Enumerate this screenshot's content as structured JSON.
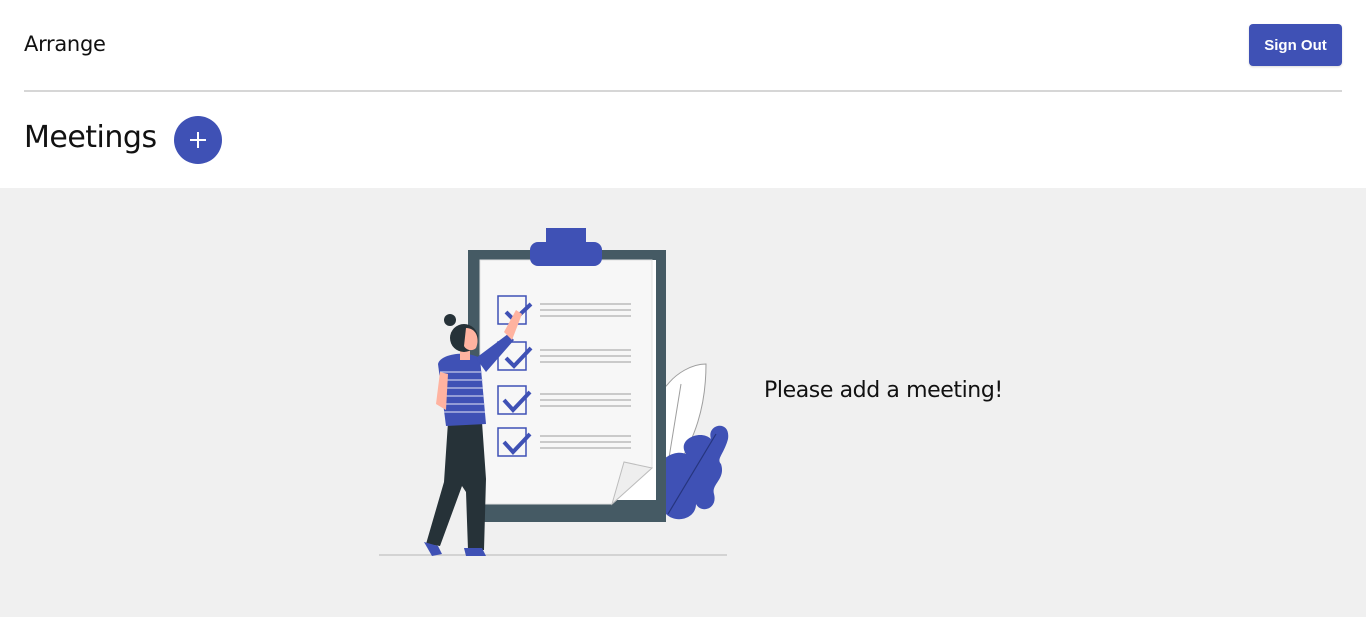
{
  "app": {
    "name": "Arrange"
  },
  "header": {
    "sign_out_label": "Sign Out"
  },
  "section": {
    "title": "Meetings",
    "add_icon": "plus-icon"
  },
  "empty_state": {
    "message": "Please add a meeting!",
    "illustration": "person-checking-clipboard-checklist"
  },
  "colors": {
    "accent": "#3f51b5",
    "background": "#f0f0f0",
    "header_background": "#ffffff",
    "clipboard_frame": "#455a64",
    "divider": "#d6d6d6"
  }
}
